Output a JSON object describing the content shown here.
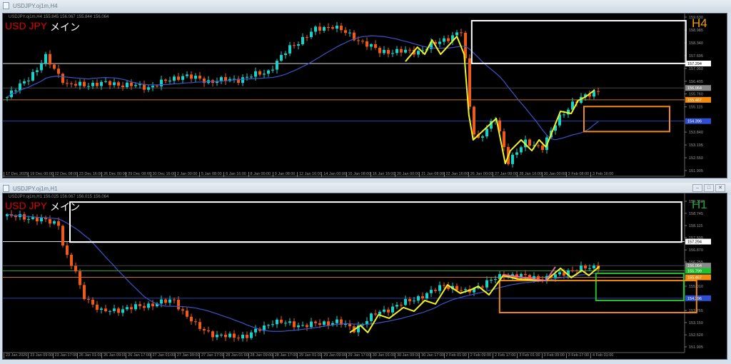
{
  "colors": {
    "up": "#1ad1c8",
    "down": "#ee5a1c",
    "ma": "#3a55c8",
    "annot": "#f2f21c",
    "pink": "#e8609a",
    "white": "#ffffff",
    "orange": "#f08a10",
    "green": "#22c030",
    "blue": "#2f4fd0",
    "gray": "#8a8a8a"
  },
  "windows": [
    {
      "title": "USDJPY.oj1m,H4",
      "info": "USDJPY.oj1m,H4  155.845 156.067 155.844 156.064",
      "symbol_label": "USD JPY",
      "main_label": "メイン",
      "timeframe": "H4",
      "timeframe_color": "#f0a000",
      "price_labels": [
        "159.630",
        "158.985",
        "158.340",
        "157.695",
        "157.050",
        "156.405",
        "155.760",
        "155.115",
        "153.840",
        "153.195",
        "152.550",
        "151.905"
      ],
      "time_labels": [
        "17 Dec 2025",
        "19 Dec 00:00",
        "22 Dec 08:00",
        "23 Dec 16:00",
        "26 Dec 00:00",
        "29 Dec 08:00",
        "30 Dec 16:00",
        "2 Jan 00:00",
        "5 Jan 08:00",
        "6 Jan 16:00",
        "8 Jan 00:00",
        "9 Jan 08:00",
        "12 Jan 16:00",
        "14 Jan 00:00",
        "15 Jan 08:00",
        "16 Jan 16:00",
        "20 Jan 00:00",
        "21 Jan 08:00",
        "22 Jan 16:00",
        "26 Jan 00:00",
        "27 Jan 08:00",
        "28 Jan 16:00",
        "30 Jan 00:00",
        "2 Feb 08:00",
        "3 Feb 16:00"
      ]
    },
    {
      "title": "USDJPY.oj1m,H1",
      "info": "USDJPY.oj1m,H1  156.025 156.067 156.015 156.064",
      "symbol_label": "USD JPY",
      "main_label": "メイン",
      "timeframe": "H1",
      "timeframe_color": "#20a040",
      "price_labels": [
        "159.360",
        "158.745",
        "158.115",
        "157.500",
        "156.870",
        "156.255",
        "155.010",
        "153.765",
        "153.150",
        "152.520",
        "151.905"
      ],
      "time_labels": [
        "23 Jan 2026",
        "23 Jan 09:00",
        "23 Jan 17:00",
        "26 Jan 01:00",
        "26 Jan 09:00",
        "26 Jan 17:00",
        "27 Jan 01:00",
        "27 Jan 09:00",
        "27 Jan 17:00",
        "28 Jan 01:00",
        "28 Jan 09:00",
        "28 Jan 17:00",
        "29 Jan 01:00",
        "29 Jan 09:00",
        "29 Jan 17:00",
        "30 Jan 01:00",
        "30 Jan 09:00",
        "30 Jan 17:00",
        "2 Feb 01:00",
        "2 Feb 09:00",
        "2 Feb 17:00",
        "3 Feb 01:00",
        "3 Feb 09:00",
        "3 Feb 17:00",
        "4 Feb 01:00"
      ],
      "window_buttons": [
        "–",
        "□",
        "✕"
      ]
    }
  ],
  "chart_data": [
    {
      "type": "candlestick",
      "title": "USDJPY.oj1m,H4",
      "ylim": [
        151.905,
        159.63
      ],
      "ma_period": 20,
      "candles": 140,
      "price_waypoints": [
        [
          0,
          155.6
        ],
        [
          7,
          157.0
        ],
        [
          9,
          157.6
        ],
        [
          14,
          156.2
        ],
        [
          24,
          156.3
        ],
        [
          33,
          156.1
        ],
        [
          41,
          156.7
        ],
        [
          47,
          156.4
        ],
        [
          54,
          156.5
        ],
        [
          61,
          156.9
        ],
        [
          66,
          158.1
        ],
        [
          72,
          159.0
        ],
        [
          76,
          159.2
        ],
        [
          81,
          158.6
        ],
        [
          87,
          157.9
        ],
        [
          96,
          157.9
        ],
        [
          102,
          158.5
        ],
        [
          106,
          158.9
        ],
        [
          107,
          157.4
        ],
        [
          108.5,
          154.0
        ],
        [
          110,
          153.5
        ],
        [
          114,
          154.5
        ],
        [
          117,
          152.4
        ],
        [
          121,
          153.3
        ],
        [
          125,
          153.1
        ],
        [
          129,
          154.6
        ],
        [
          132,
          155.3
        ],
        [
          138,
          155.96
        ]
      ],
      "hlines": [
        {
          "price": 157.294,
          "label": "157.294",
          "color": "white"
        },
        {
          "price": 156.064,
          "label": "156.064",
          "color": "gray"
        },
        {
          "price": 155.467,
          "label": "155.467",
          "color": "orange"
        },
        {
          "price": 154.396,
          "label": "154.396",
          "color": "blue"
        }
      ],
      "rects": [
        {
          "from": 108.8,
          "to": 158.8,
          "top": 159.45,
          "bottom": 157.3,
          "color": "white"
        },
        {
          "from": 135,
          "to": 155,
          "top": 155.13,
          "bottom": 153.87,
          "color": "orange"
        }
      ],
      "lines": [
        {
          "color": "annot",
          "points": [
            [
              93,
              157.4
            ],
            [
              95.8,
              158.12
            ],
            [
              97.5,
              157.76
            ],
            [
              99.2,
              158.48
            ],
            [
              101.2,
              157.76
            ],
            [
              105,
              158.66
            ],
            [
              106.7,
              157.76
            ],
            [
              107.8,
              154.71
            ],
            [
              108.8,
              153.45
            ],
            [
              114.2,
              154.53
            ],
            [
              116.3,
              152.26
            ],
            [
              117.5,
              152.91
            ],
            [
              120,
              153.45
            ],
            [
              122.5,
              152.91
            ],
            [
              124.2,
              153.45
            ],
            [
              125.8,
              153.09
            ],
            [
              129.2,
              154.89
            ],
            [
              131.7,
              154.78
            ],
            [
              133.3,
              155.43
            ],
            [
              135,
              155.61
            ],
            [
              137.2,
              155.97
            ]
          ]
        }
      ]
    },
    {
      "type": "candlestick",
      "title": "USDJPY.oj1m,H1",
      "ylim": [
        151.905,
        159.36
      ],
      "ma_period": 20,
      "candles": 140,
      "price_waypoints": [
        [
          0,
          158.6
        ],
        [
          6,
          158.5
        ],
        [
          12,
          158.2
        ],
        [
          13.5,
          156.7
        ],
        [
          16,
          155.7
        ],
        [
          17.5,
          154.6
        ],
        [
          22,
          153.7
        ],
        [
          29,
          153.9
        ],
        [
          39,
          154.3
        ],
        [
          41,
          153.7
        ],
        [
          44,
          153.0
        ],
        [
          49,
          152.45
        ],
        [
          56,
          152.45
        ],
        [
          62,
          153.2
        ],
        [
          69,
          153.0
        ],
        [
          77,
          153.2
        ],
        [
          81,
          152.8
        ],
        [
          86,
          153.6
        ],
        [
          92,
          154.1
        ],
        [
          99,
          154.7
        ],
        [
          102,
          155.1
        ],
        [
          107,
          154.7
        ],
        [
          116,
          155.6
        ],
        [
          126,
          155.4
        ],
        [
          131,
          155.8
        ],
        [
          138,
          156.03
        ]
      ],
      "hlines": [
        {
          "price": 157.294,
          "label": "157.294",
          "color": "white"
        },
        {
          "price": 156.064,
          "label": "156.064",
          "color": "gray"
        },
        {
          "price": 155.799,
          "label": "155.799",
          "color": "green"
        },
        {
          "price": 155.467,
          "label": "155.467",
          "color": "orange"
        },
        {
          "price": 154.396,
          "label": "154.396",
          "color": "blue"
        }
      ],
      "rects": [
        {
          "from": 15,
          "to": 157.8,
          "top": 159.32,
          "bottom": 157.27,
          "color": "white"
        },
        {
          "from": 137.8,
          "to": 158.3,
          "top": 155.67,
          "bottom": 154.28,
          "color": "green"
        },
        {
          "from": 115.3,
          "to": 161.3,
          "top": 155.3,
          "bottom": 153.66,
          "color": "orange"
        }
      ],
      "lines": [
        {
          "color": "annot",
          "points": [
            [
              80,
              152.64
            ],
            [
              82.5,
              153.0
            ],
            [
              84.2,
              152.64
            ],
            [
              86.7,
              153.55
            ],
            [
              89.2,
              153.37
            ],
            [
              92.5,
              153.92
            ],
            [
              95,
              153.73
            ],
            [
              97.5,
              154.28
            ],
            [
              100,
              154.1
            ],
            [
              102.8,
              155.08
            ],
            [
              105.8,
              154.65
            ],
            [
              108.3,
              154.83
            ],
            [
              110,
              155.01
            ],
            [
              112.5,
              154.57
            ],
            [
              115.8,
              155.56
            ],
            [
              119.2,
              155.38
            ],
            [
              125.8,
              155.3
            ],
            [
              129.2,
              155.93
            ],
            [
              131.7,
              155.45
            ],
            [
              134.2,
              155.82
            ],
            [
              135.8,
              155.56
            ],
            [
              138.3,
              156.03
            ]
          ]
        },
        {
          "color": "pink",
          "points": [
            [
              115.8,
              155.6
            ],
            [
              125.8,
              155.3
            ],
            [
              128,
              156.0
            ]
          ]
        }
      ]
    }
  ]
}
